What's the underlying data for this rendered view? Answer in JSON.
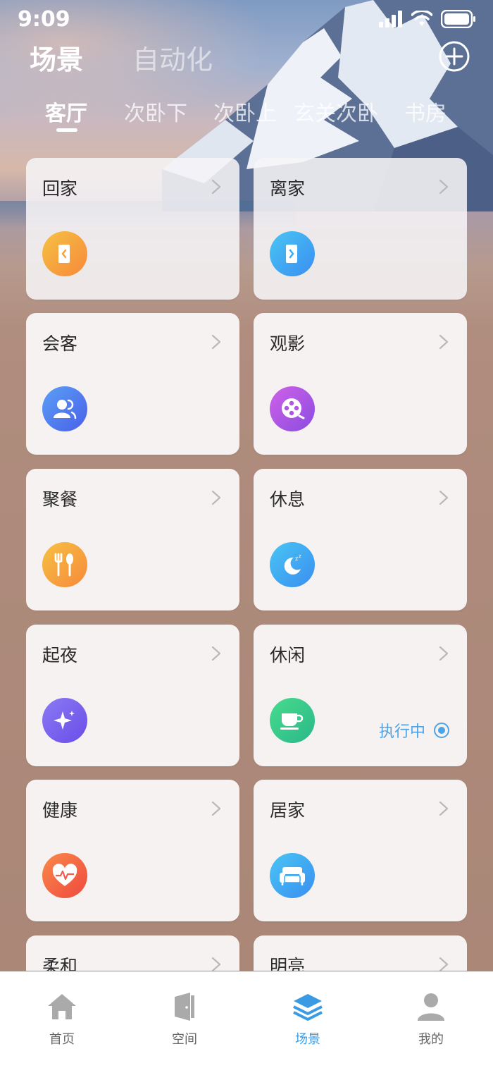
{
  "status_bar": {
    "time": "9:09"
  },
  "header": {
    "tabs": [
      {
        "label": "场景",
        "active": true
      },
      {
        "label": "自动化",
        "active": false
      }
    ]
  },
  "rooms": [
    {
      "label": "客厅",
      "active": true
    },
    {
      "label": "次卧下",
      "active": false
    },
    {
      "label": "次卧上",
      "active": false
    },
    {
      "label": "玄关次卧",
      "active": false
    },
    {
      "label": "书房",
      "active": false
    }
  ],
  "scenes": [
    {
      "title": "回家",
      "icon": "door-enter-icon",
      "color": "#f7a23b"
    },
    {
      "title": "离家",
      "icon": "door-exit-icon",
      "color": "#35aef0"
    },
    {
      "title": "会客",
      "icon": "guests-icon",
      "color": "#4d7cf0"
    },
    {
      "title": "观影",
      "icon": "film-reel-icon",
      "color": "#b156e4"
    },
    {
      "title": "聚餐",
      "icon": "fork-spoon-icon",
      "color": "#f7a23b"
    },
    {
      "title": "休息",
      "icon": "moon-sleep-icon",
      "color": "#3aa8f5"
    },
    {
      "title": "起夜",
      "icon": "sparkle-icon",
      "color": "#7a62ee"
    },
    {
      "title": "休闲",
      "icon": "coffee-cup-icon",
      "color": "#33c783",
      "status": "执行中"
    },
    {
      "title": "健康",
      "icon": "heart-pulse-icon",
      "color": "#f25c4a"
    },
    {
      "title": "居家",
      "icon": "sofa-icon",
      "color": "#3aa8f5"
    },
    {
      "title": "柔和",
      "icon": "",
      "color": ""
    },
    {
      "title": "明亮",
      "icon": "",
      "color": ""
    }
  ],
  "bottom_nav": [
    {
      "label": "首页",
      "icon": "home-icon",
      "active": false
    },
    {
      "label": "空间",
      "icon": "door-icon",
      "active": false
    },
    {
      "label": "场景",
      "icon": "layers-icon",
      "active": true
    },
    {
      "label": "我的",
      "icon": "person-icon",
      "active": false
    }
  ],
  "colors": {
    "accent": "#3a9be4",
    "inactive": "#aaaaaa"
  }
}
